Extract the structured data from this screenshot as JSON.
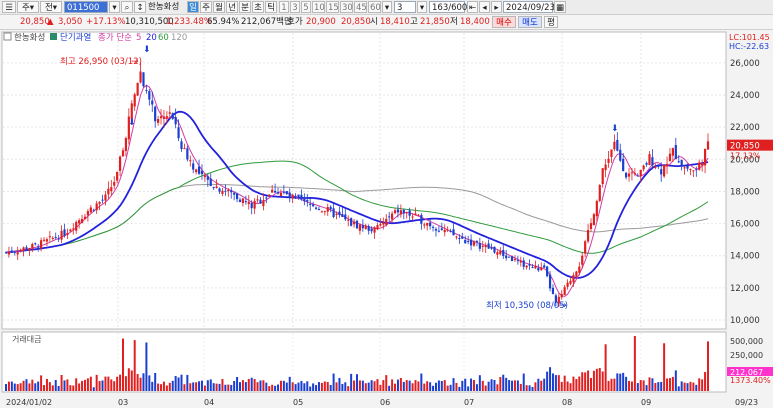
{
  "toolbar": {
    "market": "주",
    "period": "전",
    "code": "011500",
    "stock_name": "한농화성",
    "period_buttons": [
      "일",
      "주",
      "월",
      "년",
      "분",
      "초",
      "틱"
    ],
    "minute_buttons": [
      "1",
      "3",
      "5",
      "10",
      "15",
      "30",
      "45",
      "60"
    ],
    "interval_value": "3",
    "count_value": "163/600",
    "date": "2024/09/23"
  },
  "quote": {
    "price": "20,850",
    "change": "3,050",
    "change_pct": "+17.13%",
    "volume": "10,310,500",
    "volume_ratio": "1,233.48%",
    "turnover_pct": "65.94%",
    "value_label": "212,067백만",
    "hoga_label": "호가",
    "hoga_value": "20,900",
    "hoga_value2": "20,850",
    "open_label": "시",
    "open": "18,410",
    "high_label": "고",
    "high": "21,850",
    "low_label": "저",
    "low": "18,400",
    "buy_label": "매수",
    "sell_label": "매도",
    "eval_label": "평"
  },
  "legend": {
    "name": "한농화성",
    "indicator": "단기과열",
    "ma_label": "종가 단순",
    "ma_periods": [
      "5",
      "20",
      "60",
      "120"
    ],
    "lc": "LC:101.45",
    "hc": "HC:-22.63",
    "volume_title": "거래대금"
  },
  "annotations": {
    "high": "최고 26,950 (03/12)",
    "low": "최저 10,350 (08/05)"
  },
  "price_axis": {
    "ticks": [
      "26,000",
      "24,000",
      "22,000",
      "20,000",
      "18,000",
      "16,000",
      "14,000",
      "12,000",
      "10,000"
    ],
    "last_price_tag": "20,850",
    "last_change_tag": "17.13%"
  },
  "volume_axis": {
    "ticks": [
      "500,000",
      "250,000"
    ],
    "last_tag": "212,067",
    "last_pct_tag": "1373.40%"
  },
  "date_axis": {
    "ticks": [
      "2024/01/02",
      "03",
      "04",
      "05",
      "06",
      "07",
      "08",
      "09",
      "09/23"
    ]
  },
  "colors": {
    "up": "#e02020",
    "down": "#1a3fd0",
    "ma5": "#d33ca6",
    "ma20": "#2222dd",
    "ma60": "#2f9a3a",
    "ma120": "#9a9a9a",
    "highlight": "#ff33cc"
  },
  "chart_data": {
    "type": "candlestick",
    "y_range": [
      9500,
      27800
    ],
    "period": [
      "2024/01/02",
      "2024/09/23"
    ],
    "key_points": [
      {
        "date": "2024/01/02",
        "close": 14200
      },
      {
        "date": "2024/02/15",
        "close": 17600
      },
      {
        "date": "2024/03/12",
        "high": 26950
      },
      {
        "date": "2024/04/10",
        "close": 18600
      },
      {
        "date": "2024/05/15",
        "close": 17500
      },
      {
        "date": "2024/06/20",
        "close": 16300
      },
      {
        "date": "2024/07/20",
        "close": 14400
      },
      {
        "date": "2024/08/05",
        "low": 10350
      },
      {
        "date": "2024/08/20",
        "close": 20500
      },
      {
        "date": "2024/09/23",
        "open": 18410,
        "high": 21850,
        "low": 18400,
        "close": 20850
      }
    ],
    "last_volume": 10310500
  }
}
